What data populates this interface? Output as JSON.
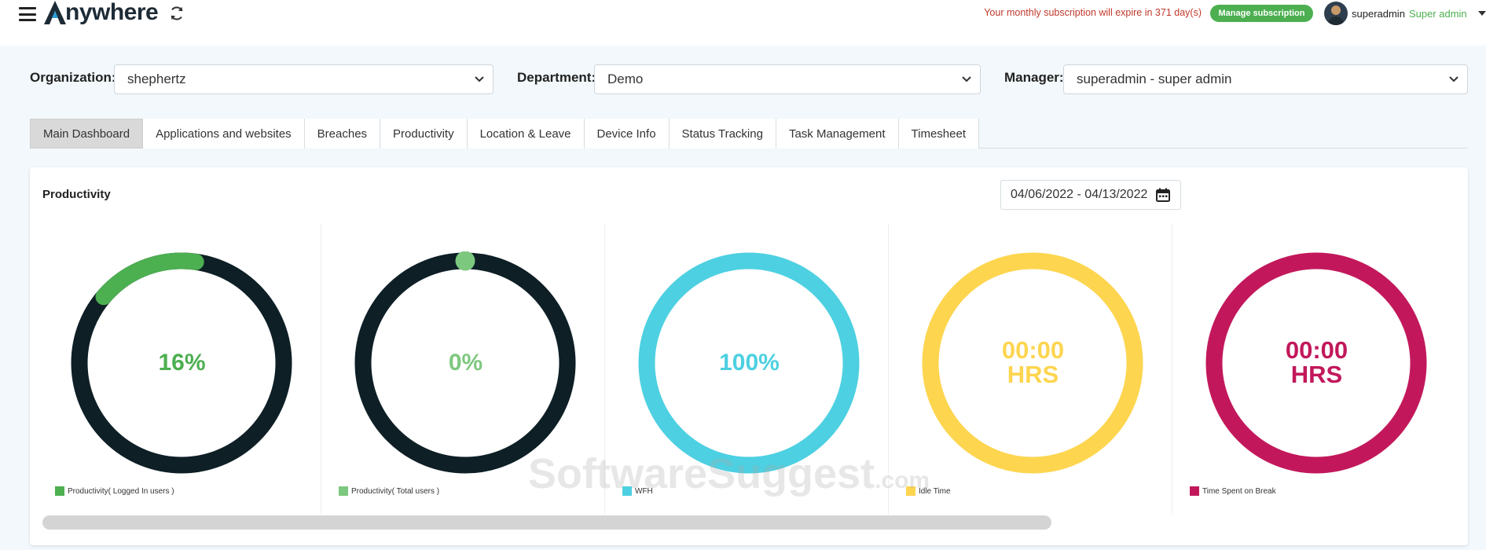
{
  "header": {
    "logo_text": "nywhere",
    "logo_letter": "A",
    "subscription_notice": "Your monthly subscription will expire in 371 day(s)",
    "manage_button": "Manage subscription",
    "user_name": "superadmin",
    "user_role": "Super admin"
  },
  "filters": {
    "organization_label": "Organization:",
    "organization_value": "shephertz",
    "department_label": "Department:",
    "department_value": "Demo",
    "manager_label": "Manager:",
    "manager_value": "superadmin - super admin"
  },
  "tabs": [
    {
      "label": "Main Dashboard",
      "active": true
    },
    {
      "label": "Applications and websites",
      "active": false
    },
    {
      "label": "Breaches",
      "active": false
    },
    {
      "label": "Productivity",
      "active": false
    },
    {
      "label": "Location & Leave",
      "active": false
    },
    {
      "label": "Device Info",
      "active": false
    },
    {
      "label": "Status Tracking",
      "active": false
    },
    {
      "label": "Task Management",
      "active": false
    },
    {
      "label": "Timesheet",
      "active": false
    }
  ],
  "card": {
    "title": "Productivity",
    "date_range": "04/06/2022 - 04/13/2022"
  },
  "donuts": [
    {
      "value_text": "16%",
      "line2": "",
      "legend": "Productivity( Logged In users )",
      "fraction": 0.16,
      "color": "#4caf50",
      "track": "#0e1f26"
    },
    {
      "value_text": "0%",
      "line2": "",
      "legend": "Productivity( Total users )",
      "fraction": 0.0,
      "color": "#7dc87f",
      "track": "#0e1f26"
    },
    {
      "value_text": "100%",
      "line2": "",
      "legend": "WFH",
      "fraction": 1.0,
      "color": "#4dd0e1",
      "track": "#4dd0e1"
    },
    {
      "value_text": "00:00",
      "line2": "HRS",
      "legend": "Idle Time",
      "fraction": 1.0,
      "color": "#fdd54f",
      "track": "#fdd54f"
    },
    {
      "value_text": "00:00",
      "line2": "HRS",
      "legend": "Time Spent on Break",
      "fraction": 1.0,
      "color": "#c2185b",
      "track": "#c2185b"
    }
  ],
  "watermark": {
    "main": "SoftwareSuggest",
    "suffix": ".com"
  },
  "colors": {
    "accent_green": "#4caf50",
    "notice_red": "#c0392b"
  }
}
